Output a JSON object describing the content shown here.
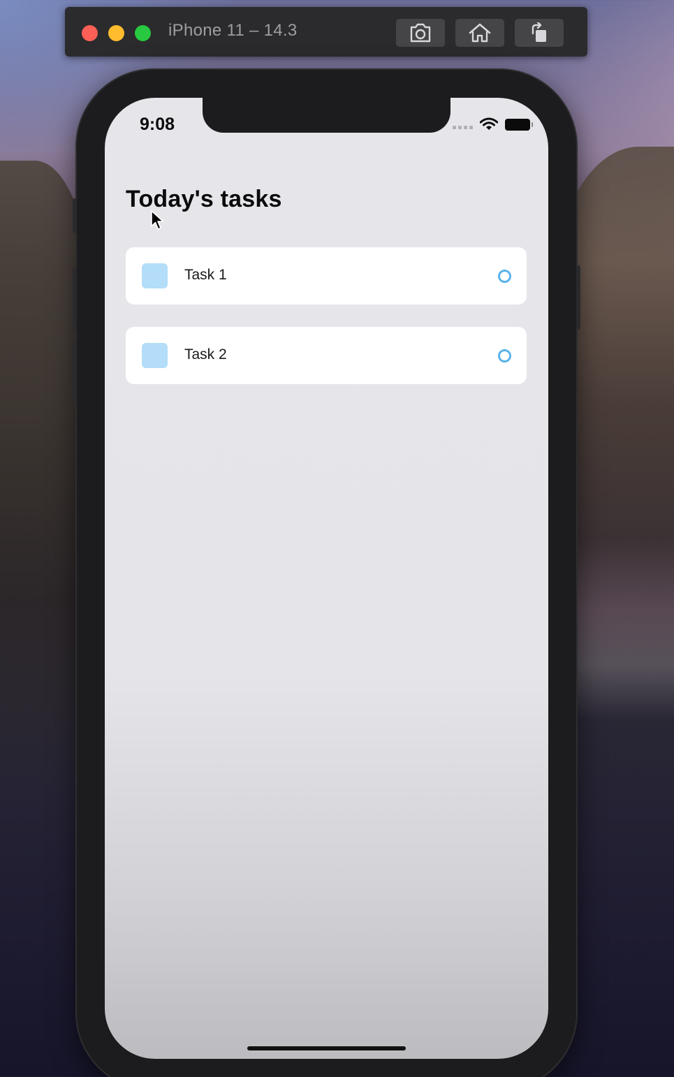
{
  "window": {
    "title": "iPhone 11 – 14.3",
    "toolbar_buttons": [
      "screenshot-icon",
      "home-icon",
      "rotate-icon"
    ]
  },
  "status_bar": {
    "time": "9:08",
    "icons": [
      "signal-icon",
      "wifi-icon",
      "battery-icon"
    ]
  },
  "page": {
    "title": "Today's tasks"
  },
  "tasks": [
    {
      "label": "Task 1",
      "completed": false
    },
    {
      "label": "Task 2",
      "completed": false
    }
  ],
  "colors": {
    "task_square": "#b3ddf8",
    "task_circle": "#59b3ea",
    "close_light": "#fe5f57",
    "minimize_light": "#febc2e",
    "zoom_light": "#28c840"
  }
}
